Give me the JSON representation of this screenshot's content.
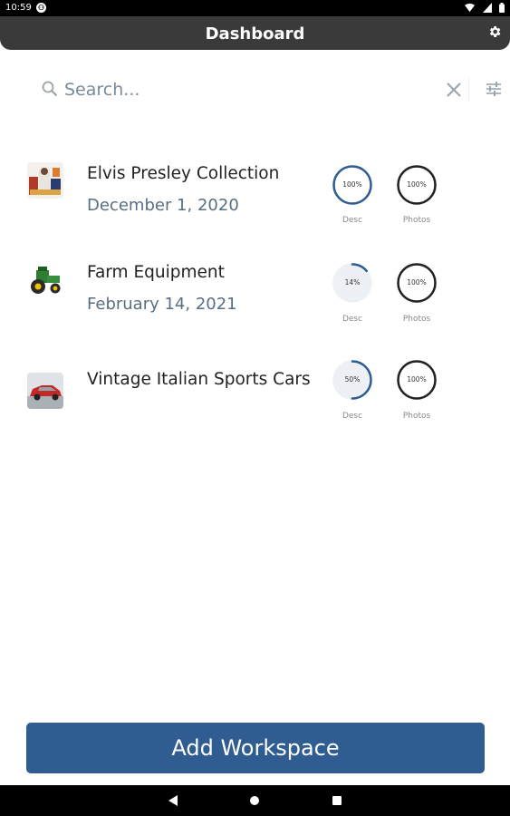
{
  "status_bar": {
    "time": "10:59",
    "notification_icon": "app-notification-icon",
    "icons": [
      "wifi-icon",
      "cell-signal-icon",
      "battery-icon"
    ]
  },
  "header": {
    "title": "Dashboard",
    "settings_icon": "gear-icon"
  },
  "search": {
    "placeholder": "Search...",
    "value": "",
    "clear_icon": "close-icon",
    "filter_icon": "sliders-icon"
  },
  "colors": {
    "accent": "#2f5d91",
    "appbar": "#3a3a3a",
    "ring_progress": "#2f5d91",
    "ring_complete": "#222222",
    "ring_track": "#e8ecf2"
  },
  "workspaces": [
    {
      "title": "Elvis Presley Collection",
      "date": "December 1, 2020",
      "thumbnail": "collection-thumbnail",
      "desc": {
        "label": "Desc",
        "text": "100%",
        "value": 1.0,
        "color": "#2f5d91"
      },
      "photos": {
        "label": "Photos",
        "text": "100%",
        "value": 1.0,
        "color": "#222222"
      }
    },
    {
      "title": "Farm Equipment",
      "date": "February 14, 2021",
      "thumbnail": "tractor-thumbnail",
      "desc": {
        "label": "Desc",
        "text": "14%",
        "value": 0.14,
        "color": "#2f5d91"
      },
      "photos": {
        "label": "Photos",
        "text": "100%",
        "value": 1.0,
        "color": "#222222"
      }
    },
    {
      "title": "Vintage Italian Sports Cars",
      "date": "",
      "thumbnail": "car-thumbnail",
      "desc": {
        "label": "Desc",
        "text": "50%",
        "value": 0.5,
        "color": "#2f5d91"
      },
      "photos": {
        "label": "Photos",
        "text": "100%",
        "value": 1.0,
        "color": "#222222"
      }
    }
  ],
  "footer": {
    "add_workspace_label": "Add Workspace"
  },
  "nav_bar": {
    "back_icon": "back-triangle-icon",
    "home_icon": "home-circle-icon",
    "recents_icon": "recents-square-icon"
  }
}
